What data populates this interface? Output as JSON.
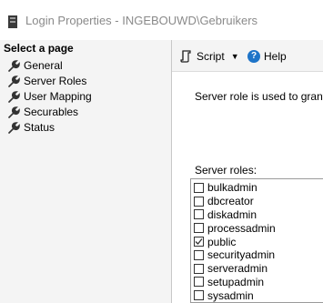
{
  "window": {
    "title": "Login Properties - INGEBOUWD\\Gebruikers"
  },
  "sidebar": {
    "header": "Select a page",
    "items": [
      {
        "label": "General"
      },
      {
        "label": "Server Roles"
      },
      {
        "label": "User Mapping"
      },
      {
        "label": "Securables"
      },
      {
        "label": "Status"
      }
    ]
  },
  "toolbar": {
    "script_label": "Script",
    "dropdown_glyph": "▼",
    "help_label": "Help",
    "help_glyph": "?"
  },
  "main": {
    "description": "Server role is used to grant s",
    "roles_label": "Server roles:",
    "roles": [
      {
        "name": "bulkadmin",
        "checked": false
      },
      {
        "name": "dbcreator",
        "checked": false
      },
      {
        "name": "diskadmin",
        "checked": false
      },
      {
        "name": "processadmin",
        "checked": false
      },
      {
        "name": "public",
        "checked": true
      },
      {
        "name": "securityadmin",
        "checked": false
      },
      {
        "name": "serveradmin",
        "checked": false
      },
      {
        "name": "setupadmin",
        "checked": false
      },
      {
        "name": "sysadmin",
        "checked": false
      }
    ]
  }
}
